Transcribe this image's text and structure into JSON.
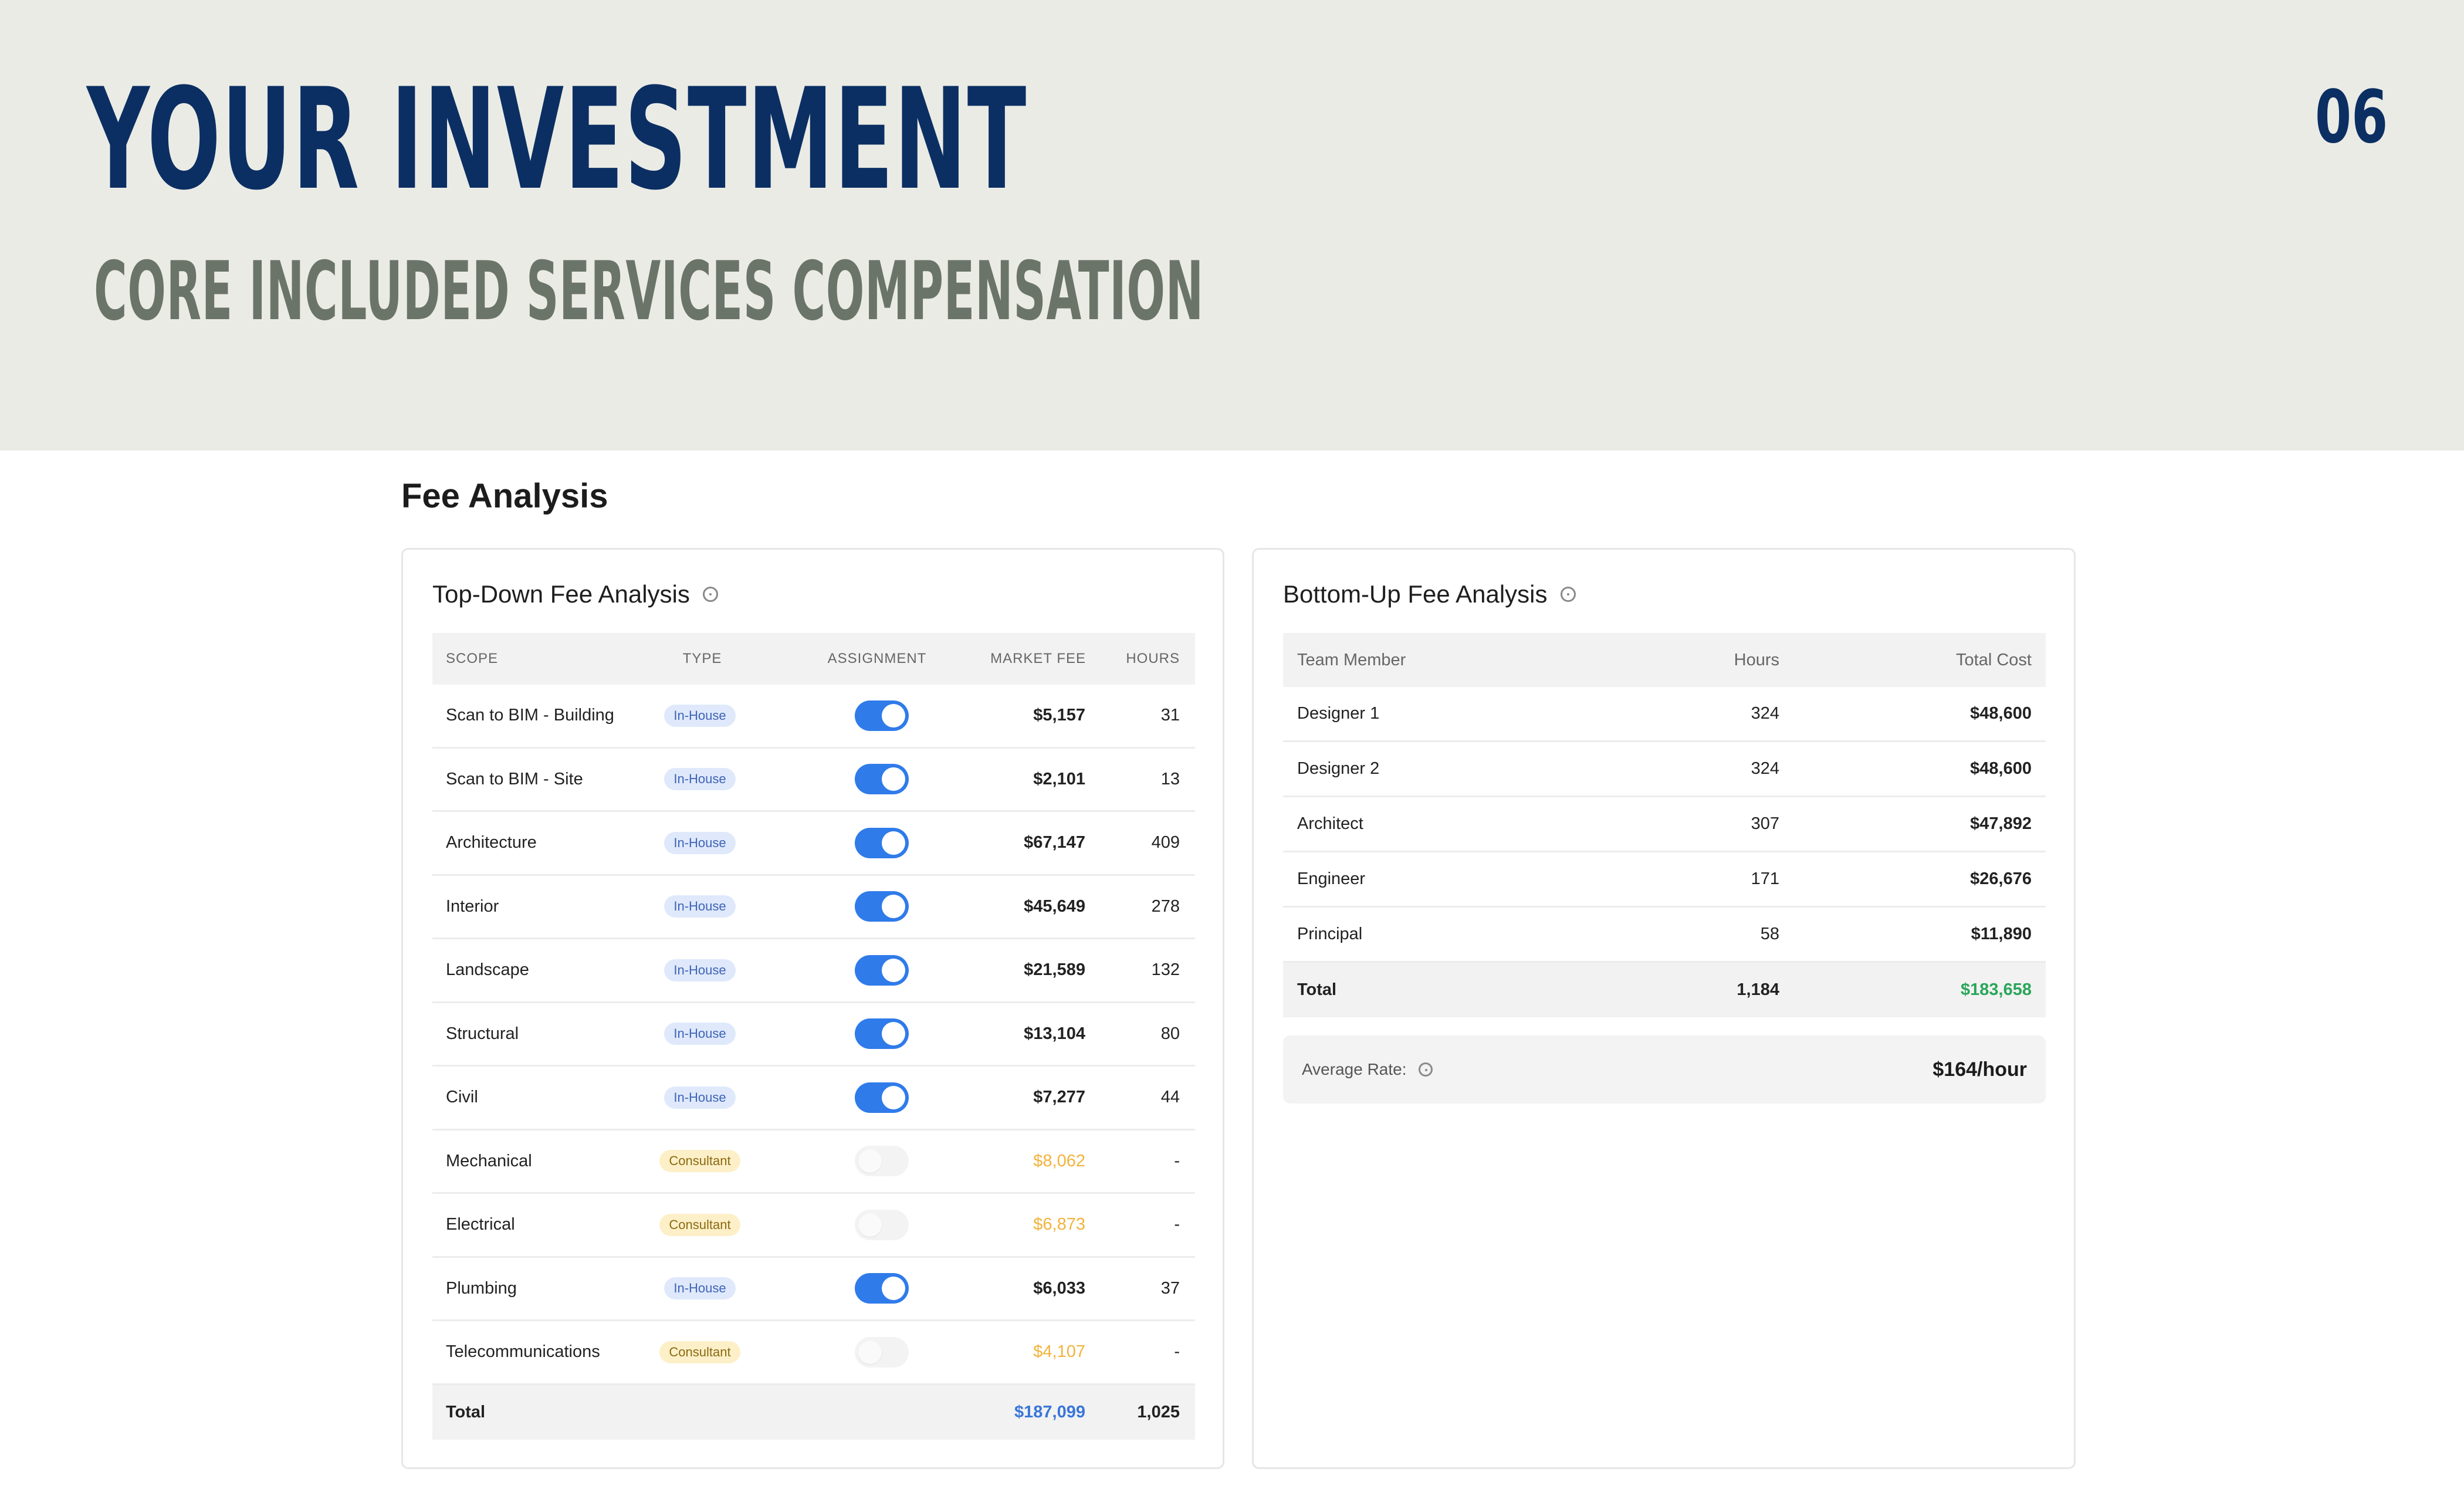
{
  "header": {
    "title": "YOUR INVESTMENT",
    "subtitle": "CORE INCLUDED SERVICES COMPENSATION",
    "page_number": "06",
    "background_color": "#ebebe5",
    "title_color": "#0b2f63",
    "subtitle_color": "#6b7469"
  },
  "section_title": "Fee Analysis",
  "top_down": {
    "title": "Top-Down Fee Analysis",
    "info_icon": "info-icon",
    "columns": [
      "SCOPE",
      "TYPE",
      "ASSIGNMENT",
      "MARKET FEE",
      "HOURS"
    ],
    "rows": [
      {
        "scope": "Scan to BIM - Building",
        "type": "In-House",
        "assigned": true,
        "market_fee": "$5,157",
        "hours": "31"
      },
      {
        "scope": "Scan to BIM - Site",
        "type": "In-House",
        "assigned": true,
        "market_fee": "$2,101",
        "hours": "13"
      },
      {
        "scope": "Architecture",
        "type": "In-House",
        "assigned": true,
        "market_fee": "$67,147",
        "hours": "409"
      },
      {
        "scope": "Interior",
        "type": "In-House",
        "assigned": true,
        "market_fee": "$45,649",
        "hours": "278"
      },
      {
        "scope": "Landscape",
        "type": "In-House",
        "assigned": true,
        "market_fee": "$21,589",
        "hours": "132"
      },
      {
        "scope": "Structural",
        "type": "In-House",
        "assigned": true,
        "market_fee": "$13,104",
        "hours": "80"
      },
      {
        "scope": "Civil",
        "type": "In-House",
        "assigned": true,
        "market_fee": "$7,277",
        "hours": "44"
      },
      {
        "scope": "Mechanical",
        "type": "Consultant",
        "assigned": false,
        "market_fee": "$8,062",
        "hours": "-"
      },
      {
        "scope": "Electrical",
        "type": "Consultant",
        "assigned": false,
        "market_fee": "$6,873",
        "hours": "-"
      },
      {
        "scope": "Plumbing",
        "type": "In-House",
        "assigned": true,
        "market_fee": "$6,033",
        "hours": "37"
      },
      {
        "scope": "Telecommunications",
        "type": "Consultant",
        "assigned": false,
        "market_fee": "$4,107",
        "hours": "-"
      }
    ],
    "total": {
      "label": "Total",
      "market_fee": "$187,099",
      "hours": "1,025"
    }
  },
  "bottom_up": {
    "title": "Bottom-Up Fee Analysis",
    "info_icon": "info-icon",
    "columns": [
      "Team Member",
      "Hours",
      "Total Cost"
    ],
    "rows": [
      {
        "member": "Designer 1",
        "hours": "324",
        "cost": "$48,600"
      },
      {
        "member": "Designer 2",
        "hours": "324",
        "cost": "$48,600"
      },
      {
        "member": "Architect",
        "hours": "307",
        "cost": "$47,892"
      },
      {
        "member": "Engineer",
        "hours": "171",
        "cost": "$26,676"
      },
      {
        "member": "Principal",
        "hours": "58",
        "cost": "$11,890"
      }
    ],
    "total": {
      "label": "Total",
      "hours": "1,184",
      "cost": "$183,658"
    },
    "average_rate": {
      "label": "Average Rate:",
      "value": "$164/hour"
    }
  },
  "colors": {
    "toggle_on": "#2f7bea",
    "in_house_badge": "#dfe9fb",
    "consultant_badge": "#fdf0c8",
    "consultant_fee": "#f2b33c",
    "total_blue": "#3a76d9",
    "total_green": "#2aa65a"
  }
}
